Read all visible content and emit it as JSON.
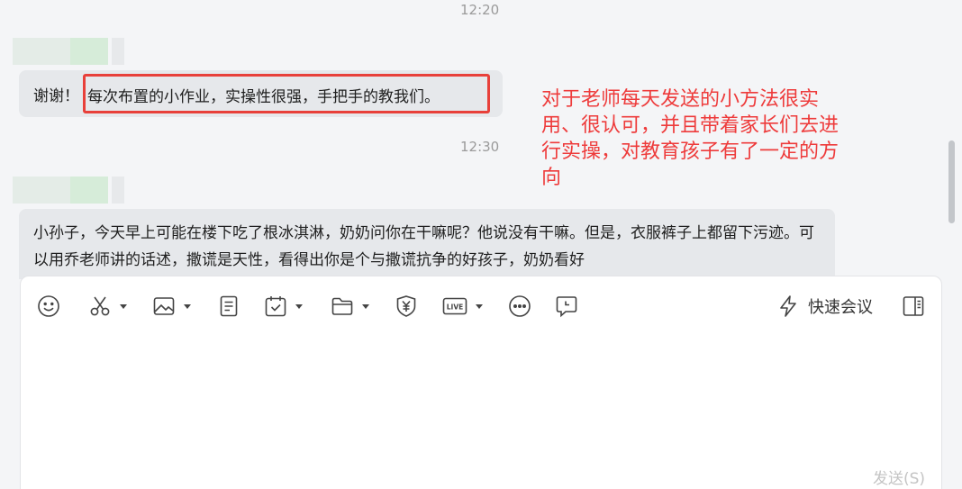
{
  "chat": {
    "timestamps": [
      "12:20",
      "12:30"
    ],
    "message1": {
      "prefix": "谢谢！",
      "highlighted": "每次布置的小作业，实操性很强，手把手的教我们。"
    },
    "message2": {
      "text": "小孙子，今天早上可能在楼下吃了根冰淇淋，奶奶问你在干嘛呢？他说没有干嘛。但是，衣服裤子上都留下污迹。可以用乔老师讲的话述，撒谎是天性，看得出你是个与撒谎抗争的好孩子，奶奶看好"
    }
  },
  "annotation": {
    "text": "对于老师每天发送的小方法很实用、很认可，并且带着家长们去进行实操，对教育孩子有了一定的方向",
    "color": "#ee3b3b"
  },
  "toolbar": {
    "items": [
      {
        "icon": "emoji-icon"
      },
      {
        "icon": "scissors-icon",
        "dropdown": true
      },
      {
        "icon": "image-icon",
        "dropdown": true
      },
      {
        "icon": "document-icon"
      },
      {
        "icon": "calendar-icon",
        "dropdown": true
      },
      {
        "icon": "folder-icon",
        "dropdown": true
      },
      {
        "icon": "yuan-shield-icon"
      },
      {
        "icon": "live-icon",
        "dropdown": true
      },
      {
        "icon": "more-icon"
      },
      {
        "icon": "comment-icon"
      }
    ],
    "quick_meeting_label": "快速会议",
    "sidebar_icon": "sidebar-toggle-icon"
  },
  "composer": {
    "send_label": "发送(S)"
  },
  "colors": {
    "highlight_border": "#e8403a",
    "bubble_bg": "#e6e8eb",
    "page_bg": "#f4f5f7"
  }
}
